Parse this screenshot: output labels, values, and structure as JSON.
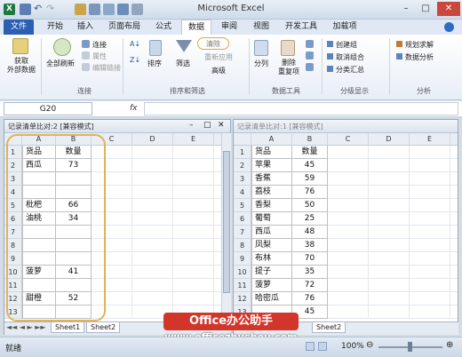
{
  "app": {
    "title": "Microsoft Excel"
  },
  "tabs": [
    "文件",
    "开始",
    "插入",
    "页面布局",
    "公式",
    "数据",
    "审阅",
    "视图",
    "开发工具",
    "加载项"
  ],
  "ribbon": {
    "get_external": "获取\n外部数据",
    "refresh_all": "全部刷新",
    "connections": "连接",
    "properties": "属性",
    "edit_links": "编辑链接",
    "sort": "排序",
    "filter": "筛选",
    "clear": "清除",
    "reapply": "重新应用",
    "advanced": "高级",
    "split": "分列",
    "remove_dup": "删除\n重复项",
    "group": "创建组",
    "ungroup": "取消组合",
    "subtotal": "分类汇总",
    "solver": "规划求解",
    "data_analysis": "数据分析",
    "groups": {
      "connections": "连接",
      "sort_filter": "排序和筛选",
      "data_tools": "数据工具",
      "outline": "分级显示",
      "analysis": "分析"
    }
  },
  "formula": {
    "namebox": "G20",
    "fx": "fx"
  },
  "left_window": {
    "title": "记录清单比对:2  [兼容模式]",
    "columns": [
      "A",
      "B",
      "C",
      "D",
      "E"
    ],
    "rows": [
      [
        "1",
        "货品",
        "数量"
      ],
      [
        "2",
        "西瓜",
        "73"
      ],
      [
        "3",
        "",
        ""
      ],
      [
        "4",
        "",
        ""
      ],
      [
        "5",
        "枇杷",
        "66"
      ],
      [
        "6",
        "油桃",
        "34"
      ],
      [
        "7",
        "",
        ""
      ],
      [
        "8",
        "",
        ""
      ],
      [
        "9",
        "",
        ""
      ],
      [
        "10",
        "菠萝",
        "41"
      ],
      [
        "11",
        "",
        ""
      ],
      [
        "12",
        "甜橙",
        "52"
      ],
      [
        "13",
        "",
        ""
      ]
    ],
    "sheet_tab": "Sheet1",
    "sheet_tab2": "Sheet2"
  },
  "right_window": {
    "title": "记录清单比对:1  [兼容模式]",
    "columns": [
      "A",
      "B",
      "C",
      "D",
      "E"
    ],
    "rows": [
      [
        "1",
        "货品",
        "数量"
      ],
      [
        "2",
        "苹果",
        "45"
      ],
      [
        "3",
        "香蕉",
        "59"
      ],
      [
        "4",
        "荔枝",
        "76"
      ],
      [
        "5",
        "香梨",
        "50"
      ],
      [
        "6",
        "葡萄",
        "25"
      ],
      [
        "7",
        "西瓜",
        "48"
      ],
      [
        "8",
        "凤梨",
        "38"
      ],
      [
        "9",
        "布林",
        "70"
      ],
      [
        "10",
        "提子",
        "35"
      ],
      [
        "11",
        "菠萝",
        "72"
      ],
      [
        "12",
        "哈密瓜",
        "76"
      ],
      [
        "13",
        "",
        "45"
      ]
    ],
    "sheet_tab": "Sheet2"
  },
  "status": {
    "ready": "就绪",
    "zoom": "100%"
  },
  "watermark": {
    "brand": "Office办公助手",
    "url": "www.officezhushou.com"
  }
}
